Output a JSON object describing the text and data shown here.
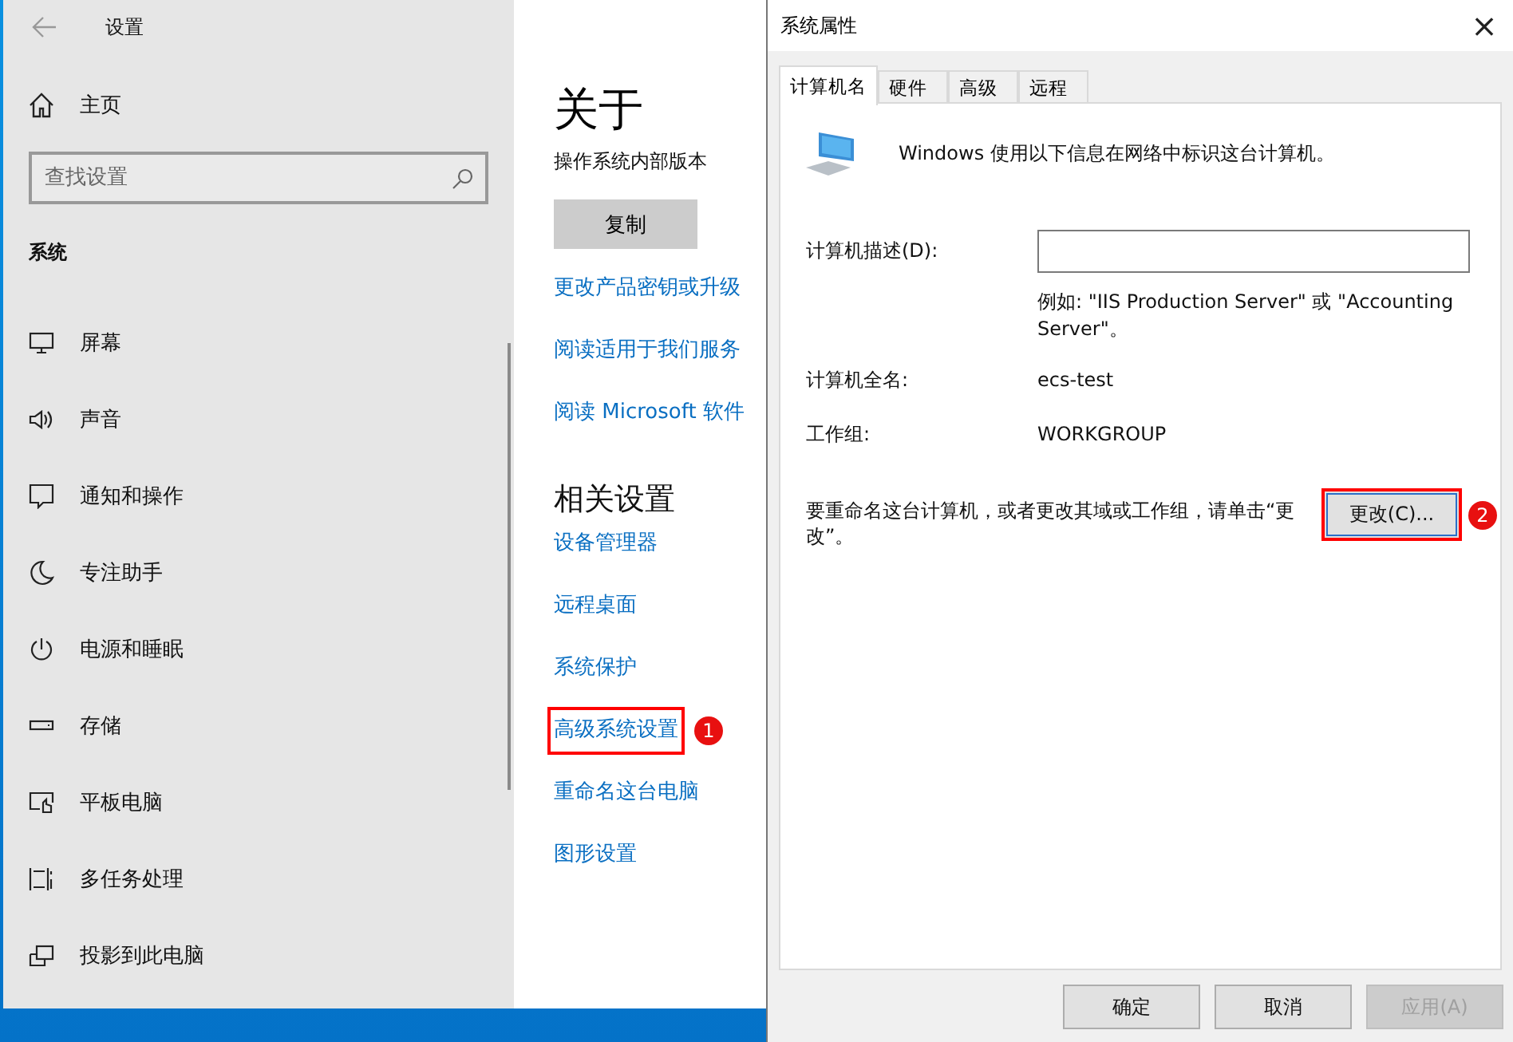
{
  "settings": {
    "title": "设置",
    "home": "主页",
    "search": {
      "placeholder": "查找设置"
    },
    "section": "系统",
    "nav": [
      {
        "label": "屏幕"
      },
      {
        "label": "声音"
      },
      {
        "label": "通知和操作"
      },
      {
        "label": "专注助手"
      },
      {
        "label": "电源和睡眠"
      },
      {
        "label": "存储"
      },
      {
        "label": "平板电脑"
      },
      {
        "label": "多任务处理"
      },
      {
        "label": "投影到此电脑"
      }
    ],
    "page_title": "关于",
    "subtitle": "操作系统内部版本",
    "copy_button": "复制",
    "links": [
      {
        "label": "更改产品密钥或升级"
      },
      {
        "label": "阅读适用于我们服务"
      },
      {
        "label": "阅读 Microsoft 软件"
      }
    ],
    "related_title": "相关设置",
    "related_links": [
      {
        "label": "设备管理器",
        "highlighted": false
      },
      {
        "label": "远程桌面",
        "highlighted": false
      },
      {
        "label": "系统保护",
        "highlighted": false
      },
      {
        "label": "高级系统设置",
        "highlighted": true,
        "marker": "1"
      },
      {
        "label": "重命名这台电脑",
        "highlighted": false
      },
      {
        "label": "图形设置",
        "highlighted": false
      }
    ]
  },
  "dialog": {
    "title": "系统属性",
    "close": "×",
    "tabs": [
      {
        "label": "计算机名",
        "selected": true
      },
      {
        "label": "硬件",
        "selected": false
      },
      {
        "label": "高级",
        "selected": false
      },
      {
        "label": "远程",
        "selected": false
      }
    ],
    "intro": "Windows 使用以下信息在网络中标识这台计算机。",
    "description_label": "计算机描述(D):",
    "example": "例如: \"IIS Production Server\" 或 \"Accounting Server\"。",
    "full_name_label": "计算机全名:",
    "full_name": "ecs-test",
    "workgroup_label": "工作组:",
    "workgroup": "WORKGROUP",
    "rename_text": "要重命名这台计算机，或者更改其域或工作组，请单击“更改”。",
    "change_button": {
      "label": "更改(C)...",
      "highlighted": true,
      "marker": "2"
    },
    "buttons": [
      {
        "label": "确定",
        "disabled": false
      },
      {
        "label": "取消",
        "disabled": false
      },
      {
        "label": "应用(A)",
        "disabled": true
      }
    ]
  }
}
